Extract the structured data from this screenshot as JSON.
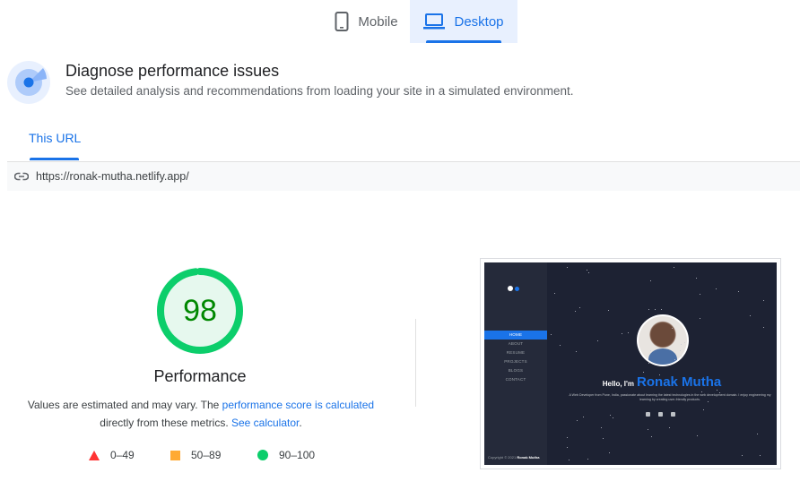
{
  "device_tabs": {
    "mobile_label": "Mobile",
    "desktop_label": "Desktop",
    "selected": "Desktop"
  },
  "header": {
    "title": "Diagnose performance issues",
    "subtitle": "See detailed analysis and recommendations from loading your site in a simulated environment."
  },
  "url_section": {
    "tab_label": "This URL",
    "url": "https://ronak-mutha.netlify.app/"
  },
  "score": {
    "value": "98",
    "fraction": 0.98,
    "label": "Performance",
    "color": "#0cce6b"
  },
  "note": {
    "text1": "Values are estimated and may vary. The ",
    "link1": "performance score is calculated",
    "text2": " directly from these metrics. ",
    "link2": "See calculator",
    "text3": "."
  },
  "legend": {
    "fail": "0–49",
    "average": "50–89",
    "pass": "90–100",
    "colors": {
      "fail": "#ff3333",
      "average": "#ffaa33",
      "pass": "#0cce6b"
    }
  },
  "screenshot": {
    "nav_items": [
      "HOME",
      "ABOUT",
      "RESUME",
      "PROJECTS",
      "BLOGS",
      "CONTACT"
    ],
    "active_nav": "HOME",
    "hello": "Hello, I'm",
    "name": "Ronak Mutha",
    "description": "A Web Developer from Pune, India, passionate about learning the latest technologies in the web development domain. I enjoy engineering my learning by creating user-friendly products.",
    "copyright_prefix": "Copyright © 2021",
    "copyright_name": "Ronak Mutha"
  },
  "icons": {
    "mobile": "phone-icon",
    "desktop": "laptop-icon",
    "diagnose": "radar-icon",
    "url": "link-icon"
  }
}
